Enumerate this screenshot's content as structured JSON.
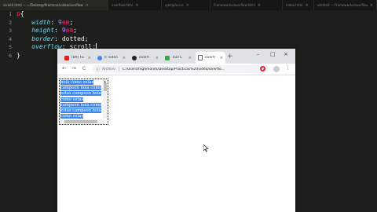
{
  "editor": {
    "tabs": [
      {
        "title": "scrollX.html — ~/Desktop/Practicas/video/overflow",
        "close": "×",
        "active": true
      },
      {
        "title": "overflow.html",
        "close": "×",
        "active": false
      },
      {
        "title": "ejemplo.css",
        "close": "×",
        "active": false
      },
      {
        "title": "Frameworks/overflow.html",
        "close": "×",
        "active": false
      },
      {
        "title": "index.html",
        "close": "×",
        "active": false
      },
      {
        "title": "untitled — Frameworks/overflow.html",
        "close": "×",
        "active": false
      }
    ],
    "lines": [
      {
        "n": "1",
        "sel": "p",
        "brace": "{"
      },
      {
        "n": "2",
        "prop": "width",
        "num": "9",
        "unit": "em"
      },
      {
        "n": "3",
        "prop": "height",
        "num": "9",
        "unit": "em"
      },
      {
        "n": "4",
        "prop": "border",
        "val": "dotted"
      },
      {
        "n": "5",
        "prop": "overflow",
        "val": "scroll"
      },
      {
        "n": "6",
        "brace": "}"
      }
    ]
  },
  "browser": {
    "tabs": [
      {
        "label": "(89) Fa",
        "close": "×",
        "color": "#e62117"
      },
      {
        "label": "Ir video",
        "close": "×",
        "color": "#4285f4"
      },
      {
        "label": "overfl",
        "close": "×",
        "color": "#202124"
      },
      {
        "label": "Tool C",
        "close": "×",
        "color": "#34a853"
      },
      {
        "label": "overfl",
        "close": "×",
        "color": "#ffffff",
        "active": true
      }
    ],
    "new_tab": "+",
    "window_controls": {
      "minimize": "–",
      "maximize": "□",
      "close": "×"
    },
    "toolbar": {
      "back": "←",
      "forward": "→",
      "reload": "C",
      "info": "ⓘ",
      "security_label": "Archivo",
      "url": "C:/Users/highmonm/Desktop/Practicas%20video/overflo...",
      "star": "☆",
      "menu": "⋮"
    },
    "page": {
      "words": "hola como estas campeon hola como estas campeon hola como estas campeon hola como estas campeon hola como estas"
    }
  },
  "colors": {
    "selection": "#3a85ee",
    "editor_bg": "#1e1f1c"
  }
}
